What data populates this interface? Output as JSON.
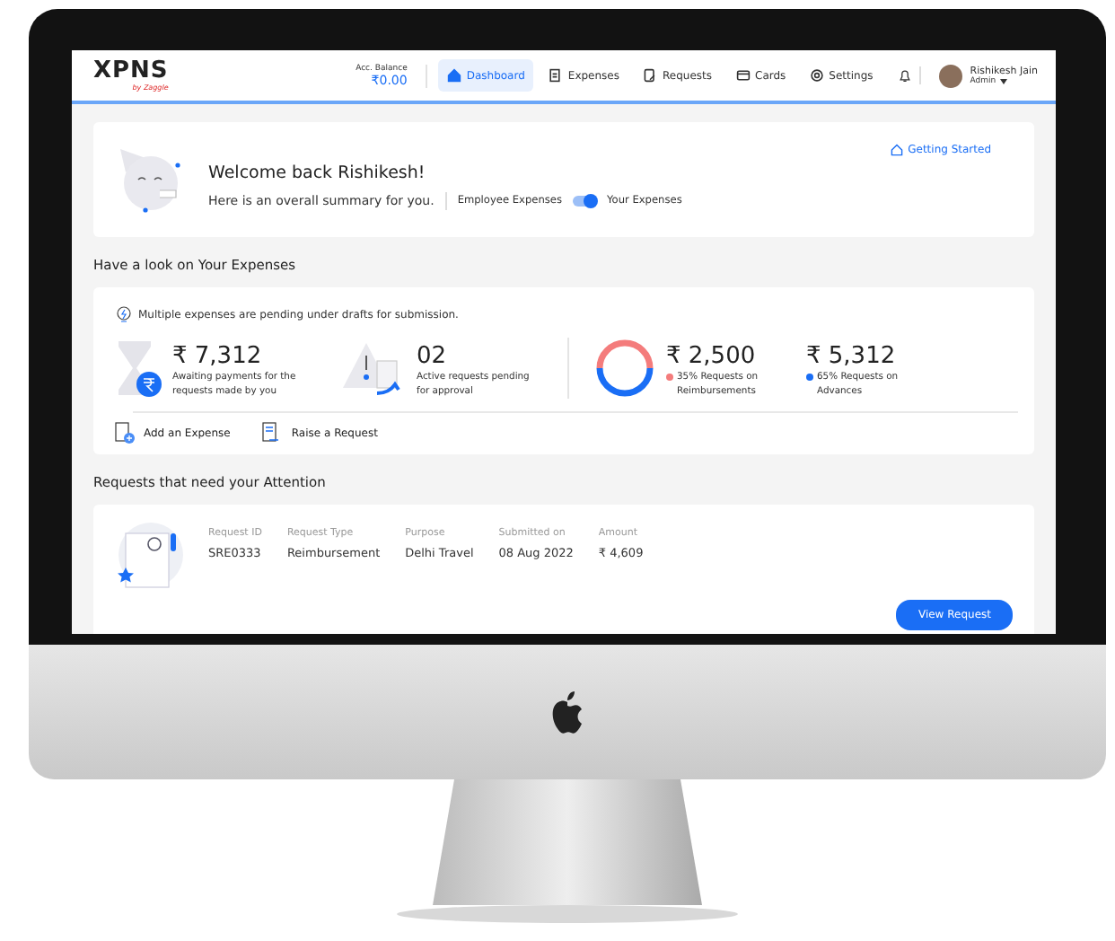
{
  "header": {
    "logo": "XPNS",
    "logo_byline": "by Zaggle",
    "balance_label": "Acc. Balance",
    "balance_value": "₹0.00",
    "nav": [
      {
        "label": "Dashboard",
        "kind": "home",
        "selected": true
      },
      {
        "label": "Expenses",
        "kind": "receipt",
        "selected": false
      },
      {
        "label": "Requests",
        "kind": "request",
        "selected": false
      },
      {
        "label": "Cards",
        "kind": "card",
        "selected": false
      },
      {
        "label": "Settings",
        "kind": "gear",
        "selected": false
      }
    ],
    "user": {
      "name": "Rishikesh Jain",
      "role": "Admin"
    }
  },
  "welcome": {
    "title": "Welcome back Rishikesh!",
    "subtitle": "Here is an overall summary for you.",
    "toggle_left": "Employee Expenses",
    "toggle_right": "Your Expenses",
    "toggle_on": true,
    "link": "Getting Started"
  },
  "expenses": {
    "title": "Have a look on Your Expenses",
    "tip": "Multiple expenses are pending under drafts for submission.",
    "stats": [
      {
        "kind": "hourglass",
        "value": "₹ 7,312",
        "caption": "Awaiting payments for the requests made by you"
      },
      {
        "kind": "warning",
        "value": "02",
        "caption": "Active requests pending for approval"
      }
    ],
    "split": [
      {
        "value": "₹ 2,500",
        "percent": "35%",
        "caption": "Requests on Reimbursements",
        "color": "#f47c7c"
      },
      {
        "value": "₹ 5,312",
        "percent": "65%",
        "caption": "Requests on Advances",
        "color": "#1a6ef5"
      }
    ],
    "actions": [
      {
        "kind": "add",
        "label": "Add an Expense"
      },
      {
        "kind": "raise",
        "label": "Raise a Request"
      }
    ]
  },
  "requests": {
    "title": "Requests that need your Attention",
    "columns": [
      "Request ID",
      "Request Type",
      "Purpose",
      "Submitted on",
      "Amount"
    ],
    "rows": [
      {
        "cells": [
          "SRE0333",
          "Reimbursement",
          "Delhi Travel",
          "08 Aug 2022",
          "₹ 4,609"
        ],
        "button": "View Request"
      }
    ]
  }
}
